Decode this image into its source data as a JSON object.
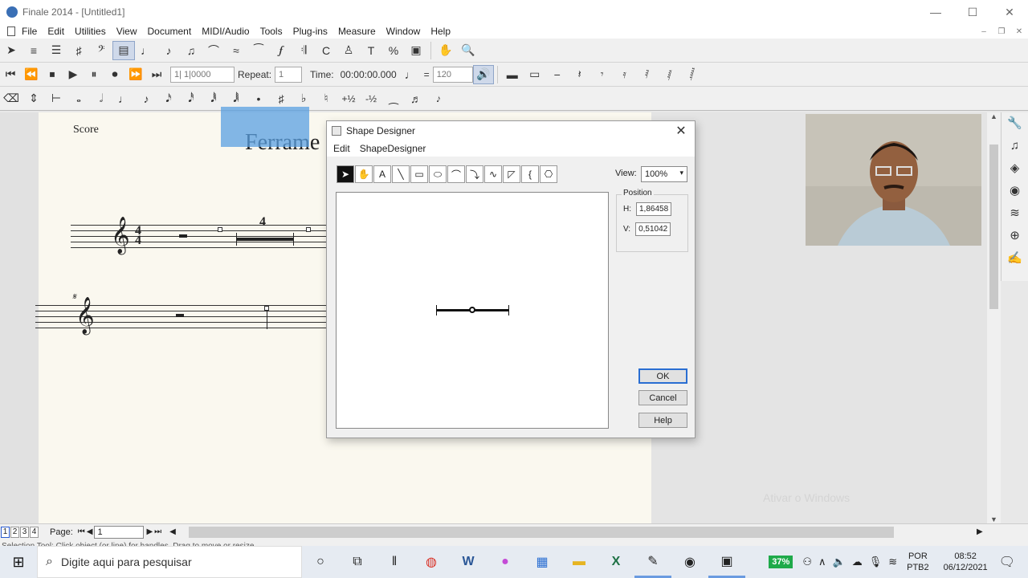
{
  "window": {
    "title": "Finale 2014 - [Untitled1]"
  },
  "menu": [
    "File",
    "Edit",
    "Utilities",
    "View",
    "Document",
    "MIDI/Audio",
    "Tools",
    "Plug-ins",
    "Measure",
    "Window",
    "Help"
  ],
  "playback": {
    "measure_value": "1| 1|0000",
    "repeat_label": "Repeat:",
    "repeat_value": "1",
    "time_label": "Time:",
    "time_value": "00:00:00.000",
    "tempo_value": "120"
  },
  "smart_shapes": [
    "+½",
    "-½"
  ],
  "score": {
    "label": "Score",
    "title": "Ferrame",
    "time_sig_top": "4",
    "time_sig_bottom": "4",
    "measure_count": "4"
  },
  "dialog": {
    "title": "Shape Designer",
    "menu": [
      "Edit",
      "ShapeDesigner"
    ],
    "view_label": "View:",
    "view_value": "100%",
    "position_label": "Position",
    "h_label": "H:",
    "h_value": "1,86458",
    "v_label": "V:",
    "v_value": "0,51042",
    "ok_label": "OK",
    "cancel_label": "Cancel",
    "help_label": "Help"
  },
  "pagebar": {
    "pages": [
      "1",
      "2",
      "3",
      "4"
    ],
    "page_label": "Page:",
    "page_value": "1"
  },
  "status_text": "Selection Tool: Click object (or line) for handles. Drag to move or resize.",
  "watermark": "Ativar o Windows",
  "taskbar": {
    "search_placeholder": "Digite aqui para pesquisar",
    "battery": "37%",
    "lang_top": "POR",
    "lang_bottom": "PTB2",
    "time": "08:52",
    "date": "06/12/2021"
  },
  "colors": {
    "selection": "#5aa0e1",
    "battery": "#1faa4a",
    "accent": "#2a6ed2"
  }
}
